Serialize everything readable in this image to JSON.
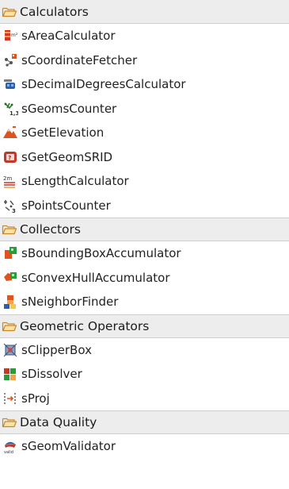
{
  "groups": [
    {
      "label": "Calculators",
      "items": [
        {
          "label": "sAreaCalculator",
          "icon": "area-calculator-icon"
        },
        {
          "label": "sCoordinateFetcher",
          "icon": "coordinate-fetcher-icon"
        },
        {
          "label": "sDecimalDegreesCalculator",
          "icon": "decimal-degrees-icon"
        },
        {
          "label": "sGeomsCounter",
          "icon": "geoms-counter-icon"
        },
        {
          "label": "sGetElevation",
          "icon": "elevation-icon"
        },
        {
          "label": "sGetGeomSRID",
          "icon": "srid-icon"
        },
        {
          "label": "sLengthCalculator",
          "icon": "length-calculator-icon"
        },
        {
          "label": "sPointsCounter",
          "icon": "points-counter-icon"
        }
      ]
    },
    {
      "label": "Collectors",
      "items": [
        {
          "label": "sBoundingBoxAccumulator",
          "icon": "bounding-box-icon"
        },
        {
          "label": "sConvexHullAccumulator",
          "icon": "convex-hull-icon"
        },
        {
          "label": "sNeighborFinder",
          "icon": "neighbor-finder-icon"
        }
      ]
    },
    {
      "label": "Geometric Operators",
      "items": [
        {
          "label": "sClipperBox",
          "icon": "clipper-box-icon"
        },
        {
          "label": "sDissolver",
          "icon": "dissolver-icon"
        },
        {
          "label": "sProj",
          "icon": "projection-icon"
        }
      ]
    },
    {
      "label": "Data Quality",
      "items": [
        {
          "label": "sGeomValidator",
          "icon": "geom-validator-icon"
        }
      ]
    }
  ],
  "colors": {
    "header_bg": "#ededed",
    "folder_stroke": "#c8872a",
    "folder_fill": "#fbe3a8"
  }
}
